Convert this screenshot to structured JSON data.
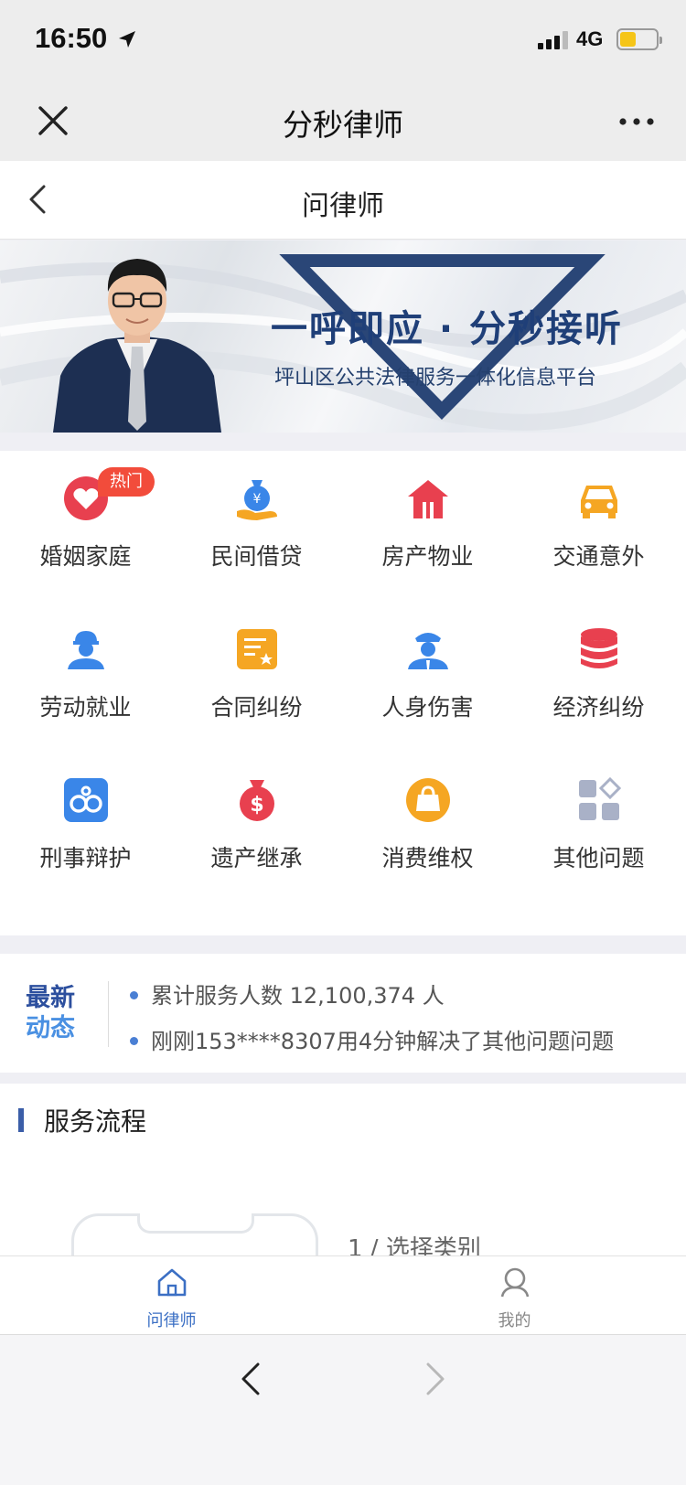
{
  "status_bar": {
    "time": "16:50",
    "network": "4G",
    "battery_level": 0.45
  },
  "wechat_nav": {
    "title": "分秒律师"
  },
  "page_header": {
    "title": "问律师"
  },
  "banner": {
    "slogan": "一呼即应 · 分秒接听",
    "subtitle": "坪山区公共法律服务一体化信息平台"
  },
  "categories": [
    {
      "label": "婚姻家庭",
      "icon": "heart-icon",
      "badge": "热门"
    },
    {
      "label": "民间借贷",
      "icon": "money-bag-icon"
    },
    {
      "label": "房产物业",
      "icon": "house-icon"
    },
    {
      "label": "交通意外",
      "icon": "car-icon"
    },
    {
      "label": "劳动就业",
      "icon": "worker-icon"
    },
    {
      "label": "合同纠纷",
      "icon": "contract-icon"
    },
    {
      "label": "人身伤害",
      "icon": "police-icon"
    },
    {
      "label": "经济纠纷",
      "icon": "coins-stack-icon"
    },
    {
      "label": "刑事辩护",
      "icon": "handcuffs-icon"
    },
    {
      "label": "遗产继承",
      "icon": "dollar-bag-icon"
    },
    {
      "label": "消费维权",
      "icon": "shopping-bag-icon"
    },
    {
      "label": "其他问题",
      "icon": "grid-icon"
    }
  ],
  "news": {
    "tag_line1": "最新",
    "tag_line2": "动态",
    "items": [
      "累计服务人数 12,100,374 人",
      "刚刚153****8307用4分钟解决了其他问题问题"
    ]
  },
  "process": {
    "title": "服务流程",
    "step_label": "1 / 选择类别"
  },
  "tabbar": {
    "items": [
      {
        "label": "问律师",
        "icon": "home-icon",
        "active": true
      },
      {
        "label": "我的",
        "icon": "user-icon",
        "active": false
      }
    ]
  },
  "colors": {
    "accent": "#3b6fc4",
    "hot_badge": "#f24c3b",
    "red_icon": "#e8404f",
    "blue_icon": "#3a86e8",
    "orange_icon": "#f5a623"
  }
}
